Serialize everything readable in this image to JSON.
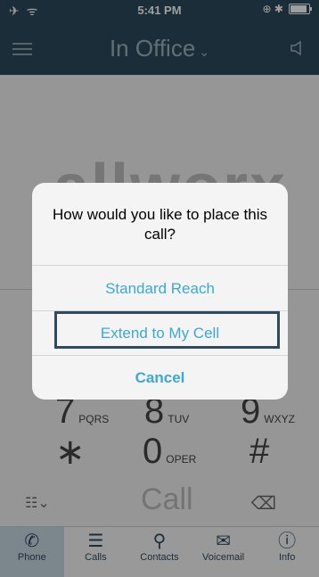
{
  "status_bar": {
    "left_icons": "✈ ᯤ",
    "time": "5:41 PM",
    "right_icons": "⊕ ✱"
  },
  "nav": {
    "title": "In Office",
    "chevron": "⌄",
    "menu_icon": "hamburger-icon",
    "speaker_icon": "speaker-icon"
  },
  "logo_text": "allworx",
  "dialpad": {
    "row3": [
      {
        "num": "7",
        "sub": "PQRS"
      },
      {
        "num": "8",
        "sub": "TUV"
      },
      {
        "num": "9",
        "sub": "WXYZ"
      }
    ],
    "row4": [
      {
        "num": "∗",
        "sub": ""
      },
      {
        "num": "0",
        "sub": "OPER"
      },
      {
        "num": "#",
        "sub": ""
      }
    ],
    "call_label": "Call",
    "toggle_glyph": "☷⌄",
    "backspace_glyph": "⌫"
  },
  "dialog": {
    "title": "How would you like to place this call?",
    "options": [
      "Standard Reach",
      "Extend to My Cell"
    ],
    "cancel": "Cancel"
  },
  "tabs": [
    {
      "label": "Phone",
      "icon": "✆"
    },
    {
      "label": "Calls",
      "icon": "☰"
    },
    {
      "label": "Contacts",
      "icon": "⚲"
    },
    {
      "label": "Voicemail",
      "icon": "✉"
    },
    {
      "label": "Info",
      "icon": "ⓘ"
    }
  ],
  "colors": {
    "navbar": "#2e4a5e",
    "accent": "#3aa9d6",
    "highlight_border": "#2e4a5e"
  }
}
